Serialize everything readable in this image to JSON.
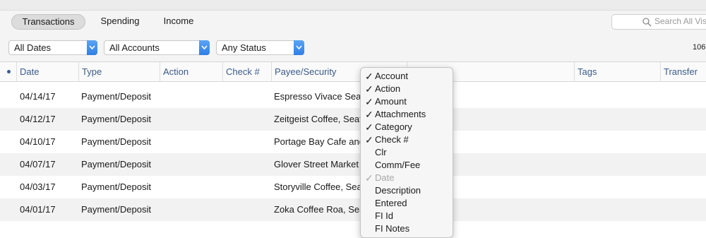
{
  "tabs": [
    {
      "label": "Transactions",
      "active": true
    },
    {
      "label": "Spending",
      "active": false
    },
    {
      "label": "Income",
      "active": false
    }
  ],
  "search": {
    "placeholder": "Search All Vis"
  },
  "filters": {
    "dates": "All Dates",
    "accounts": "All Accounts",
    "status": "Any Status"
  },
  "count_text": "106",
  "columns": {
    "date": "Date",
    "type": "Type",
    "action": "Action",
    "check": "Check #",
    "payee": "Payee/Security",
    "tags": "Tags",
    "transfer": "Transfer"
  },
  "rows": [
    {
      "date": "04/14/17",
      "type": "Payment/Deposit",
      "payee": "Espresso Vivace Seattle"
    },
    {
      "date": "04/12/17",
      "type": "Payment/Deposit",
      "payee": "Zeitgeist Coffee, Seattle"
    },
    {
      "date": "04/10/17",
      "type": "Payment/Deposit",
      "payee": "Portage Bay Cafe and"
    },
    {
      "date": "04/07/17",
      "type": "Payment/Deposit",
      "payee": "Glover Street Market"
    },
    {
      "date": "04/03/17",
      "type": "Payment/Deposit",
      "payee": "Storyville Coffee, Seattle"
    },
    {
      "date": "04/01/17",
      "type": "Payment/Deposit",
      "payee": "Zoka Coffee Roa, Seattle"
    }
  ],
  "column_menu": {
    "items": [
      {
        "label": "Account",
        "check": "✓"
      },
      {
        "label": "Action",
        "check": "✓"
      },
      {
        "label": "Amount",
        "check": "✓"
      },
      {
        "label": "Attachments",
        "check": "✓"
      },
      {
        "label": "Category",
        "check": "✓"
      },
      {
        "label": "Check #",
        "check": "✓"
      },
      {
        "label": "Clr",
        "check": ""
      },
      {
        "label": "Comm/Fee",
        "check": ""
      },
      {
        "label": "Date",
        "check": "✓"
      },
      {
        "label": "Description",
        "check": ""
      },
      {
        "label": "Entered",
        "check": ""
      },
      {
        "label": "FI Id",
        "check": ""
      },
      {
        "label": "FI Notes",
        "check": ""
      }
    ]
  },
  "colors": {
    "accent": "#2f7fe6",
    "header_text": "#3b5b8a",
    "row_alt": "#f2f2f2"
  }
}
